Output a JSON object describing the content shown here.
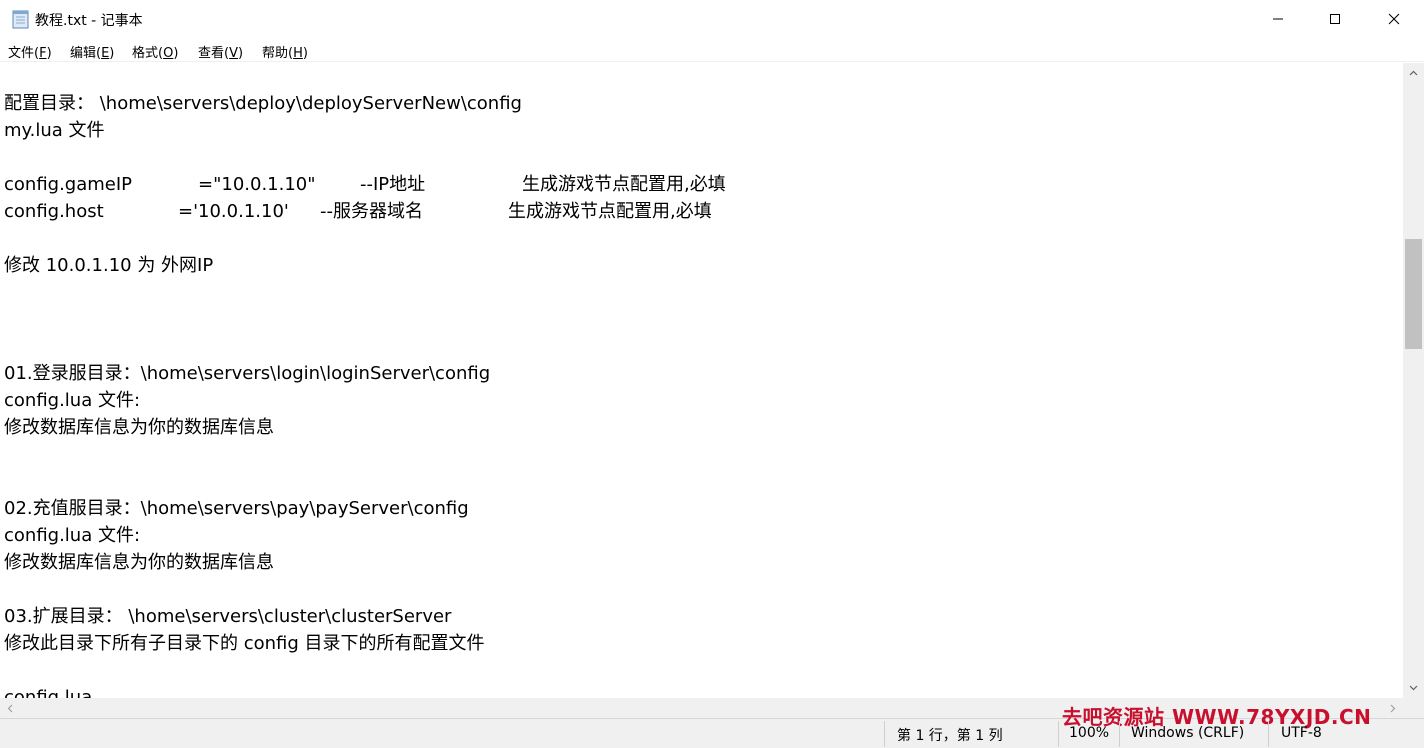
{
  "window": {
    "title": "教程.txt - 记事本"
  },
  "menu": {
    "items": [
      {
        "label": "文件(",
        "accel": "F",
        "suffix": ")"
      },
      {
        "label": "编辑(",
        "accel": "E",
        "suffix": ")"
      },
      {
        "label": "格式(",
        "accel": "O",
        "suffix": ")"
      },
      {
        "label": "查看(",
        "accel": "V",
        "suffix": ")"
      },
      {
        "label": "帮助(",
        "accel": "H",
        "suffix": ")"
      }
    ]
  },
  "document": {
    "lines": [
      "配置目录： \\home\\servers\\deploy\\deployServerNew\\config",
      "my.lua  文件",
      "",
      "config.gameIP",
      "config.host",
      "",
      "修改 10.0.1.10 为 外网IP",
      "",
      "",
      "",
      "01.登录服目录：\\home\\servers\\login\\loginServer\\config",
      "config.lua  文件:",
      "修改数据库信息为你的数据库信息",
      "",
      "",
      "02.充值服目录：\\home\\servers\\pay\\payServer\\config",
      "config.lua  文件:",
      "修改数据库信息为你的数据库信息",
      "",
      "03.扩展目录： \\home\\servers\\cluster\\clusterServer",
      "修改此目录下所有子目录下的 config 目录下的所有配置文件",
      "",
      "config.lua"
    ],
    "line3_cols": [
      "=\"10.0.1.10\"",
      "--IP地址",
      "生成游戏节点配置用,必填"
    ],
    "line4_cols": [
      "='10.0.1.10'",
      "--服务器域名",
      "生成游戏节点配置用,必填"
    ]
  },
  "statusbar": {
    "position": "第 1 行，第 1 列",
    "zoom": "100%",
    "line_ending": "Windows (CRLF)",
    "encoding": "UTF-8",
    "watermark": "去吧资源站  WWW.78YXJD.CN"
  }
}
